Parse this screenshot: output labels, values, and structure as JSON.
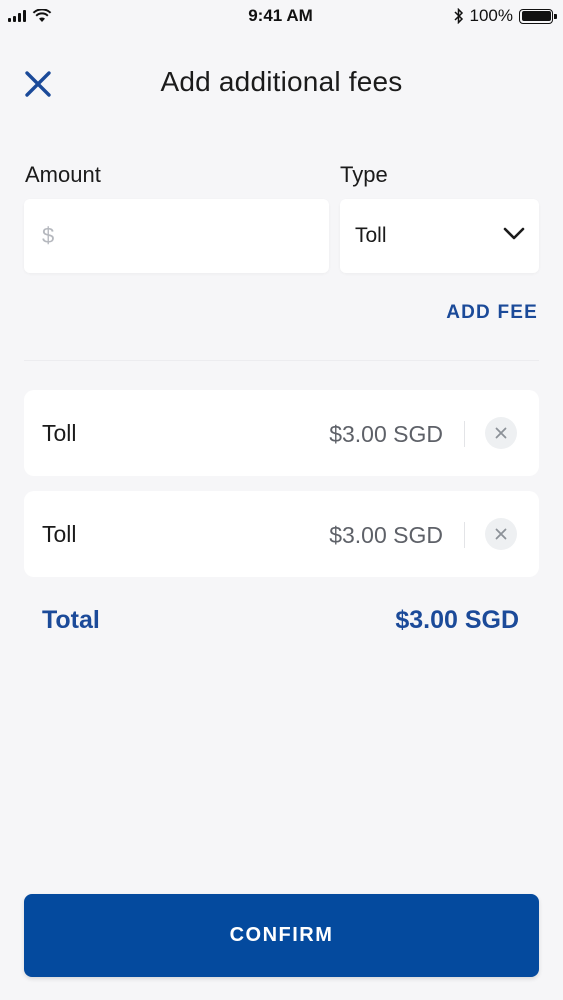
{
  "status_bar": {
    "time": "9:41 AM",
    "battery": "100%",
    "icons": [
      "signal-icon",
      "wifi-icon",
      "bluetooth-icon",
      "battery-icon"
    ]
  },
  "header": {
    "title": "Add additional fees",
    "close_icon": "close-icon"
  },
  "form": {
    "amount_label": "Amount",
    "amount_prefix": "$",
    "amount_value": "",
    "type_label": "Type",
    "type_value": "Toll",
    "add_fee_label": "ADD FEE"
  },
  "fees": [
    {
      "name": "Toll",
      "amount": "$3.00 SGD"
    },
    {
      "name": "Toll",
      "amount": "$3.00 SGD"
    }
  ],
  "total": {
    "label": "Total",
    "value": "$3.00 SGD"
  },
  "confirm_label": "CONFIRM",
  "colors": {
    "accent": "#1b4a99",
    "button": "#044a9e",
    "background": "#f6f6f8"
  }
}
